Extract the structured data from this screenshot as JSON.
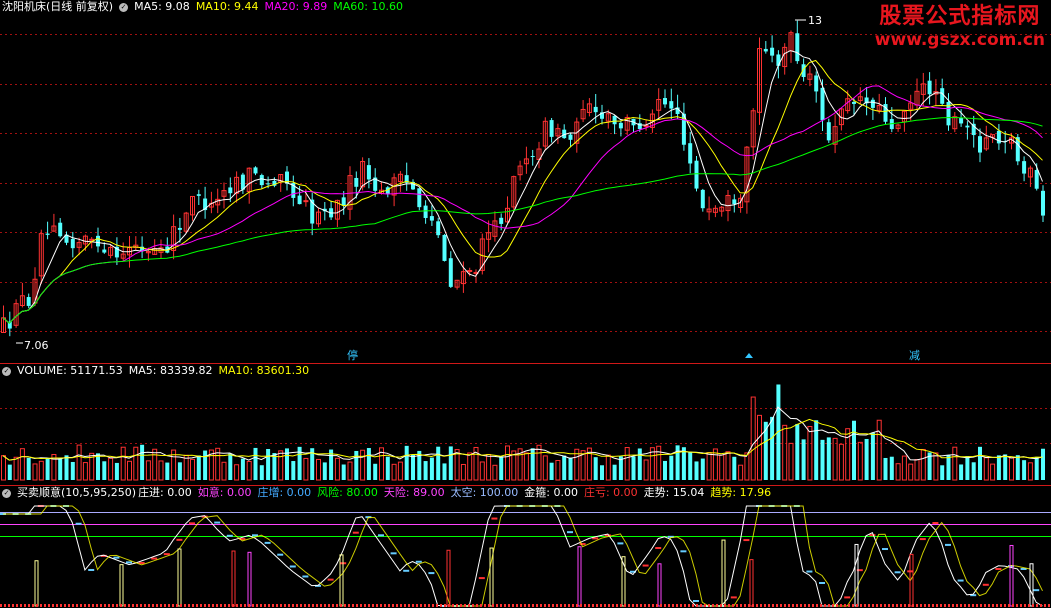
{
  "price_header": {
    "stock": "沈阳机床(日线 前复权)",
    "ma5": "MA5: 9.08",
    "ma10": "MA10: 9.44",
    "ma20": "MA20: 9.89",
    "ma60": "MA60: 10.60"
  },
  "volume_header": {
    "volume": "VOLUME: 51171.53",
    "ma5": "MA5: 83339.82",
    "ma10": "MA10: 83601.30"
  },
  "indicator_header": {
    "name": "买卖顺意(10,5,95,250)",
    "zhuangjin": "庄进: 0.00",
    "ruyi": "如意: 0.00",
    "zhuangzeng": "庄增: 0.00",
    "fengxian": "风险: 80.00",
    "tianxian": "天险: 89.00",
    "taikong": "太空: 100.00",
    "jinchou": "金箍: 0.00",
    "zhuangkui": "庄亏: 0.00",
    "zoushi": "走势: 15.04",
    "qushi": "趋势: 17.96"
  },
  "watermark": {
    "line1": "股票公式指标网",
    "line2": "www.gszx.com.cn"
  },
  "markers": {
    "ting": "停",
    "jian": "减",
    "high_label": "13",
    "low_label": "7.06"
  },
  "colors": {
    "up": "#ff3232",
    "down": "#54ffff",
    "ma5": "#ffffff",
    "ma10": "#ffff00",
    "ma20": "#ff00ff",
    "ma60": "#00ff00",
    "grid": "#a01010"
  },
  "chart_data": {
    "type": "candlestick",
    "title": "沈阳机床(日线 前复权)",
    "price_keypoints": [
      [
        0,
        7.2
      ],
      [
        30,
        7.9
      ],
      [
        45,
        9.2
      ],
      [
        60,
        8.8
      ],
      [
        90,
        8.9
      ],
      [
        130,
        8.7
      ],
      [
        165,
        8.8
      ],
      [
        190,
        9.6
      ],
      [
        220,
        9.8
      ],
      [
        250,
        10.2
      ],
      [
        290,
        9.9
      ],
      [
        315,
        9.3
      ],
      [
        340,
        9.6
      ],
      [
        360,
        10.3
      ],
      [
        380,
        9.9
      ],
      [
        410,
        10.0
      ],
      [
        430,
        9.4
      ],
      [
        450,
        8.0
      ],
      [
        470,
        8.3
      ],
      [
        490,
        9.0
      ],
      [
        510,
        9.8
      ],
      [
        530,
        10.6
      ],
      [
        550,
        11.1
      ],
      [
        570,
        10.8
      ],
      [
        590,
        11.5
      ],
      [
        610,
        11.3
      ],
      [
        630,
        11.0
      ],
      [
        660,
        11.6
      ],
      [
        680,
        11.2
      ],
      [
        700,
        9.6
      ],
      [
        720,
        9.5
      ],
      [
        740,
        9.9
      ],
      [
        750,
        11.2
      ],
      [
        760,
        12.5
      ],
      [
        775,
        12.3
      ],
      [
        790,
        12.8
      ],
      [
        800,
        12.2
      ],
      [
        815,
        11.8
      ],
      [
        830,
        10.8
      ],
      [
        845,
        11.4
      ],
      [
        860,
        11.6
      ],
      [
        880,
        11.3
      ],
      [
        900,
        11.0
      ],
      [
        915,
        11.7
      ],
      [
        930,
        11.9
      ],
      [
        945,
        11.2
      ],
      [
        960,
        11.1
      ],
      [
        980,
        10.8
      ],
      [
        1000,
        10.9
      ],
      [
        1020,
        10.5
      ],
      [
        1035,
        9.9
      ],
      [
        1050,
        9.3
      ]
    ],
    "y_range": [
      6.9,
      13.2
    ],
    "high": 13,
    "low": 7.06,
    "volume_spike_x": [
      752,
      790
    ],
    "indicator_lines": [
      "走势",
      "趋势"
    ]
  }
}
